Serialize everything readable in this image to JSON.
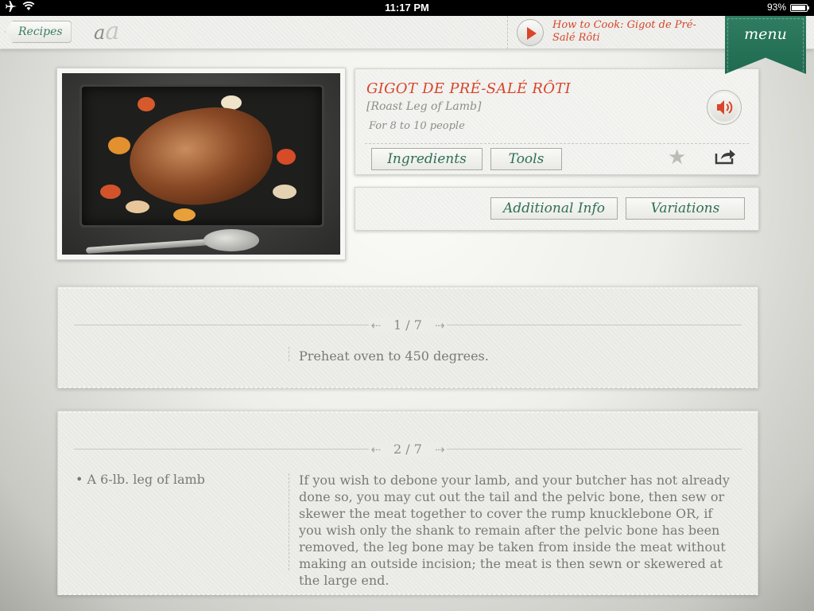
{
  "status": {
    "time": "11:17 PM",
    "battery": "93%",
    "battery_level": 0.93
  },
  "topbar": {
    "back_label": "Recipes",
    "font_toggle_small": "a",
    "font_toggle_large": "a",
    "video_title": "How to Cook: Gigot de Pré-Salé Rôti",
    "menu_label": "menu"
  },
  "recipe": {
    "title": "GIGOT DE PRÉ-SALÉ RÔTI",
    "subtitle": "[Roast Leg of Lamb]",
    "serves": "For 8 to 10 people",
    "tabs": {
      "ingredients": "Ingredients",
      "tools": "Tools",
      "additional_info": "Additional Info",
      "variations": "Variations"
    }
  },
  "steps": [
    {
      "counter": "1 / 7",
      "ingredient": "",
      "text": "Preheat oven to 450 degrees."
    },
    {
      "counter": "2 / 7",
      "ingredient": "• A 6-lb. leg of lamb",
      "text": "If you wish to debone your lamb, and your butcher has not already done so, you may cut out the tail and the pelvic bone, then sew or skewer the meat together to cover the rump knucklebone OR, if you wish only the shank to remain after the pelvic bone has been removed, the leg bone may be taken from inside the meat without making an outside incision; the meat is then sewn or skewered at the large end."
    }
  ],
  "colors": {
    "accent_red": "#d5462a",
    "accent_green": "#2f7d62"
  },
  "icons": {
    "airplane": "airplane-icon",
    "wifi": "wifi-icon",
    "battery": "battery-icon",
    "play": "play-icon",
    "speaker": "speaker-icon",
    "star": "star-icon",
    "share": "share-icon",
    "arrow_left": "arrow-left-icon",
    "arrow_right": "arrow-right-icon"
  }
}
